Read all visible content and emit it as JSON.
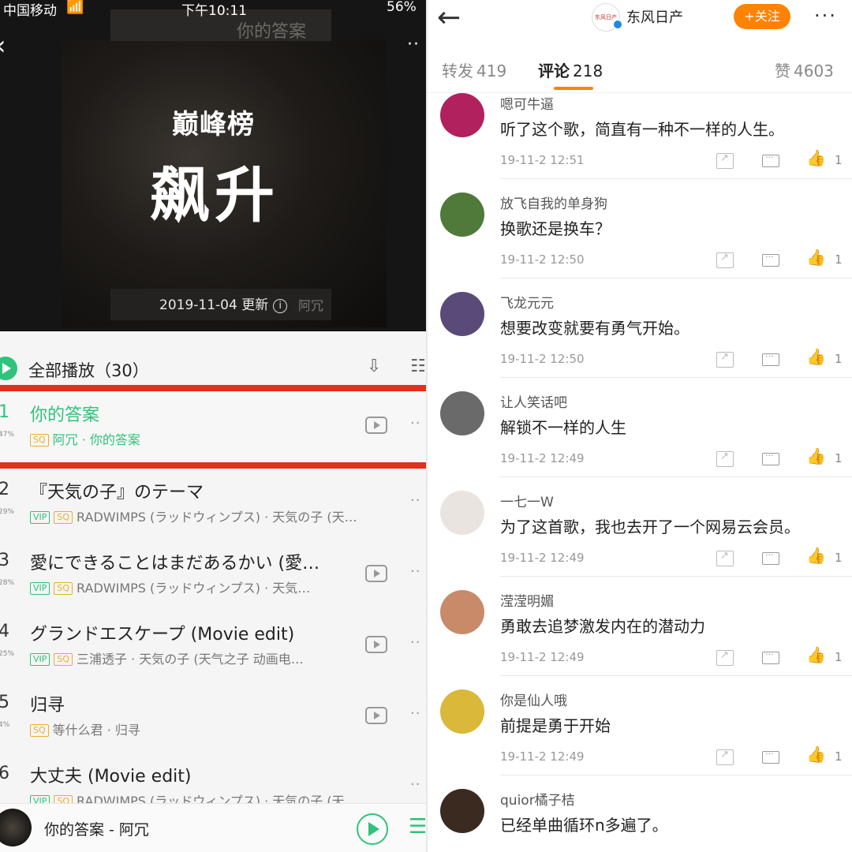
{
  "left": {
    "status": {
      "carrier": "中国移动",
      "time": "下午10:11",
      "battery": "56%"
    },
    "hero": {
      "brand": "巅峰榜",
      "title": "飙升",
      "frame_text": "你的答案",
      "update": "2019-11-04 更新",
      "artist_stamp": "阿冗"
    },
    "play_all": {
      "label": "全部播放（30）"
    },
    "songs": [
      {
        "num": "1",
        "pct": "47%",
        "title": "你的答案",
        "badges": [
          "SQ"
        ],
        "sub": "阿冗 · 你的答案",
        "mv": true
      },
      {
        "num": "2",
        "pct": "29%",
        "title": "『天気の子』のテーマ",
        "badges": [
          "VIP",
          "SQ"
        ],
        "sub": "RADWIMPS (ラッドウィンプス) · 天気の子 (天…",
        "mv": false
      },
      {
        "num": "3",
        "pct": "28%",
        "title": "愛にできることはまだあるかい (愛…",
        "badges": [
          "VIP",
          "SQ"
        ],
        "sub": "RADWIMPS (ラッドウィンプス) · 天気…",
        "mv": true
      },
      {
        "num": "4",
        "pct": "25%",
        "title": "グランドエスケープ (Movie edit)",
        "badges": [
          "VIP",
          "SQ"
        ],
        "sub": "三浦透子 · 天気の子 (天气之子 动画电…",
        "mv": true
      },
      {
        "num": "5",
        "pct": "4%",
        "title": "归寻",
        "badges": [
          "SQ"
        ],
        "sub": "等什么君 · 归寻",
        "mv": true
      },
      {
        "num": "6",
        "pct": "",
        "title": "大丈夫 (Movie edit)",
        "badges": [
          "VIP",
          "SQ"
        ],
        "sub": "RADWIMPS (ラッドウィンプス) · 天気の子 (天…",
        "mv": false
      }
    ],
    "mini_player": {
      "now_playing": "你的答案 - 阿冗"
    }
  },
  "right": {
    "topbar": {
      "account": "东风日产",
      "avatar_text": "东风日产",
      "follow": "+关注"
    },
    "tabs": [
      {
        "label": "转发",
        "count": "419"
      },
      {
        "label": "评论",
        "count": "218"
      },
      {
        "label": "赞",
        "count": "4603"
      }
    ],
    "comments": [
      {
        "user": "嗯可牛逼",
        "text": "听了这个歌，简直有一种不一样的人生。",
        "time": "19-11-2 12:51",
        "likes": "1",
        "avatar_color": "#b0215e"
      },
      {
        "user": "放飞自我的单身狗",
        "text": "换歌还是换车？",
        "time": "19-11-2 12:50",
        "likes": "1",
        "avatar_color": "#4f7a3a"
      },
      {
        "user": "飞龙元元",
        "text": "想要改变就要有勇气开始。",
        "time": "19-11-2 12:50",
        "likes": "1",
        "avatar_color": "#5a4a7a"
      },
      {
        "user": "让人笑话吧",
        "text": "解锁不一样的人生",
        "time": "19-11-2 12:49",
        "likes": "1",
        "avatar_color": "#6a6a6a"
      },
      {
        "user": "一七一W",
        "text": "为了这首歌，我也去开了一个网易云会员。",
        "time": "19-11-2 12:49",
        "likes": "1",
        "avatar_color": "#e9e4e0"
      },
      {
        "user": "滢滢明媚",
        "text": "勇敢去追梦激发内在的潜动力",
        "time": "19-11-2 12:49",
        "likes": "1",
        "avatar_color": "#c98a6a"
      },
      {
        "user": "你是仙人哦",
        "text": "前提是勇于开始",
        "time": "19-11-2 12:49",
        "likes": "1",
        "avatar_color": "#d9b83a"
      },
      {
        "user": "quior橘子桔",
        "text": "已经单曲循环n多遍了。",
        "time": "",
        "likes": "",
        "avatar_color": "#3a2a20"
      }
    ]
  }
}
